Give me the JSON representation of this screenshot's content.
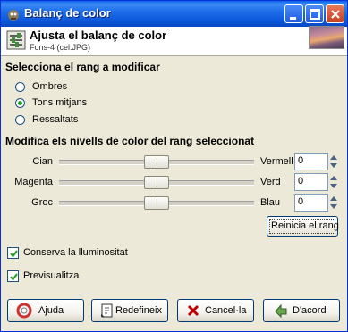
{
  "window": {
    "title": "Balanç de color"
  },
  "header": {
    "title": "Ajusta el balanç de color",
    "subtitle": "Fons-4 (cel.JPG)"
  },
  "range_section": {
    "title": "Selecciona el rang a modificar",
    "options": [
      {
        "label": "Ombres",
        "checked": false
      },
      {
        "label": "Tons mitjans",
        "checked": true
      },
      {
        "label": "Ressaltats",
        "checked": false
      }
    ]
  },
  "levels_section": {
    "title": "Modifica els nivells de color del rang seleccionat",
    "sliders": [
      {
        "left": "Cian",
        "right": "Vermell",
        "value": "0"
      },
      {
        "left": "Magenta",
        "right": "Verd",
        "value": "0"
      },
      {
        "left": "Groc",
        "right": "Blau",
        "value": "0"
      }
    ],
    "slider_range": [
      -100,
      100
    ],
    "reset_label": "Reinicia el rang"
  },
  "checks": [
    {
      "label": "Conserva la lluminositat",
      "checked": true
    },
    {
      "label": "Previsualitza",
      "checked": true
    }
  ],
  "buttons": {
    "help": "Ajuda",
    "reset": "Redefineix",
    "cancel": "Cancel·la",
    "ok": "D'acord"
  },
  "colors": {
    "titlebar": "#0a5fe8",
    "face": "#ece9d8",
    "radio_dot": "#21a121"
  }
}
